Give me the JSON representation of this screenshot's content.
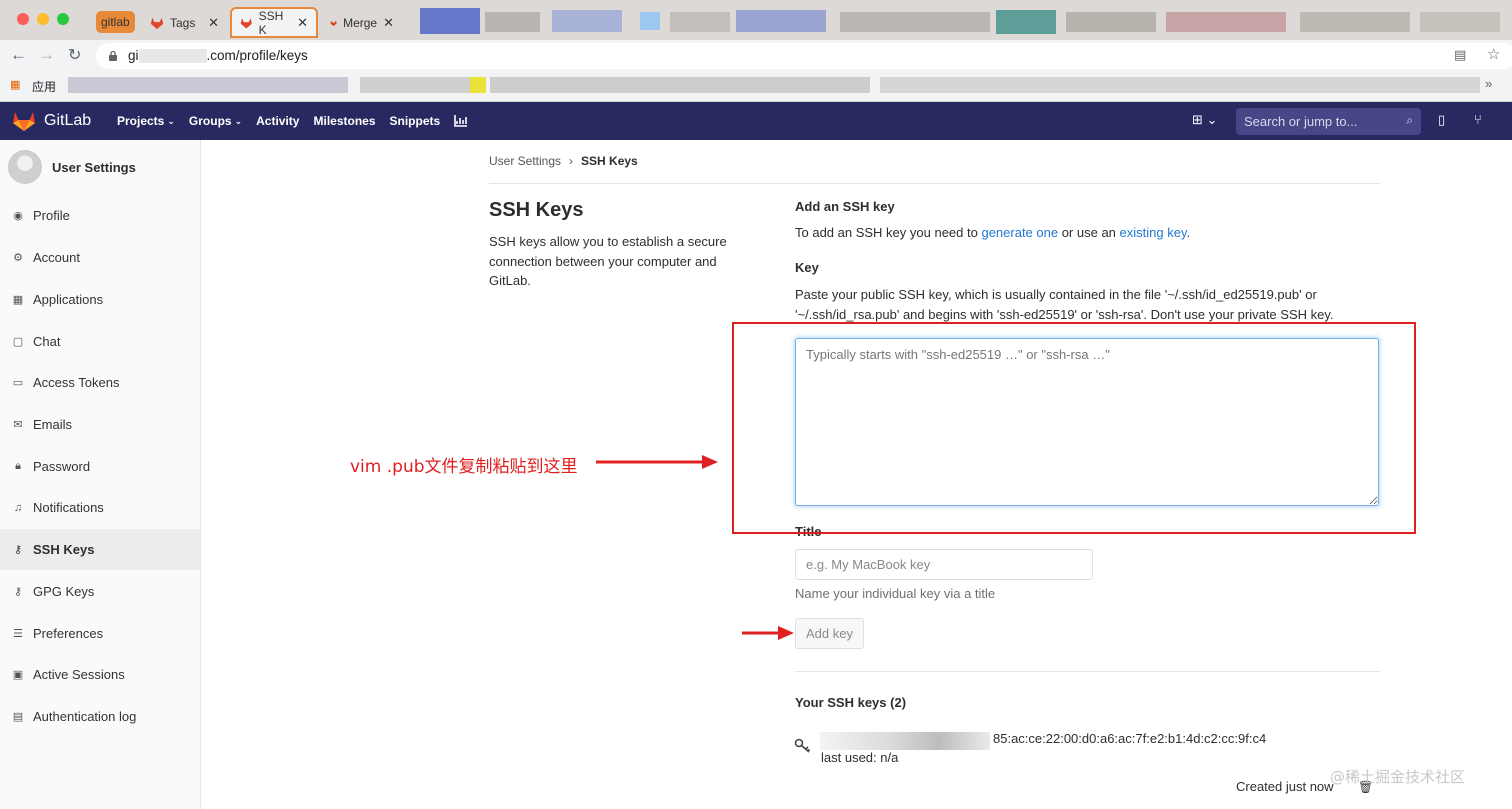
{
  "browser": {
    "tabs": [
      {
        "label": "gitlab",
        "type": "group"
      },
      {
        "label": "Tags"
      },
      {
        "label": "SSH K",
        "active": true
      },
      {
        "label": "Merge"
      }
    ],
    "url_prefix": "gi",
    "url_suffix": ".com/profile/keys",
    "bookmark_apps": "应用"
  },
  "header": {
    "brand": "GitLab",
    "nav": [
      {
        "label": "Projects",
        "dropdown": true
      },
      {
        "label": "Groups",
        "dropdown": true
      },
      {
        "label": "Activity"
      },
      {
        "label": "Milestones"
      },
      {
        "label": "Snippets"
      }
    ],
    "search_placeholder": "Search or jump to...",
    "colors": {
      "header_bg": "#292961",
      "link": "#1f78d1",
      "annotation": "#e02020"
    }
  },
  "sidebar": {
    "title": "User Settings",
    "items": [
      {
        "label": "Profile",
        "icon": "profile-icon"
      },
      {
        "label": "Account",
        "icon": "account-icon"
      },
      {
        "label": "Applications",
        "icon": "applications-icon"
      },
      {
        "label": "Chat",
        "icon": "chat-icon"
      },
      {
        "label": "Access Tokens",
        "icon": "token-icon"
      },
      {
        "label": "Emails",
        "icon": "email-icon"
      },
      {
        "label": "Password",
        "icon": "lock-icon"
      },
      {
        "label": "Notifications",
        "icon": "bell-icon"
      },
      {
        "label": "SSH Keys",
        "icon": "key-icon",
        "active": true
      },
      {
        "label": "GPG Keys",
        "icon": "key-icon"
      },
      {
        "label": "Preferences",
        "icon": "sliders-icon"
      },
      {
        "label": "Active Sessions",
        "icon": "monitor-icon"
      },
      {
        "label": "Authentication log",
        "icon": "log-icon"
      }
    ]
  },
  "breadcrumb": {
    "parent": "User Settings",
    "separator": "›",
    "current": "SSH Keys"
  },
  "section": {
    "title": "SSH Keys",
    "description": "SSH keys allow you to establish a secure connection between your computer and GitLab."
  },
  "form": {
    "heading": "Add an SSH key",
    "intro_pre": "To add an SSH key you need to ",
    "intro_link1": "generate one",
    "intro_mid": " or use an ",
    "intro_link2": "existing key",
    "intro_post": ".",
    "key_label": "Key",
    "key_help": "Paste your public SSH key, which is usually contained in the file '~/.ssh/id_ed25519.pub' or '~/.ssh/id_rsa.pub' and begins with 'ssh-ed25519' or 'ssh-rsa'. Don't use your private SSH key.",
    "key_placeholder": "Typically starts with \"ssh-ed25519 …\" or \"ssh-rsa …\"",
    "title_label": "Title",
    "title_placeholder": "e.g. My MacBook key",
    "title_hint": "Name your individual key via a title",
    "add_button": "Add key"
  },
  "keys": {
    "heading": "Your SSH keys (2)",
    "items": [
      {
        "fingerprint": "85:ac:ce:22:00:d0:a6:ac:7f:e2:b1:4d:c2:cc:9f:c4",
        "last_used": "last used: n/a",
        "created": "Created just now"
      }
    ]
  },
  "annotation": {
    "text": "vim .pub文件复制粘贴到这里"
  },
  "watermark": "@稀土掘金技术社区"
}
